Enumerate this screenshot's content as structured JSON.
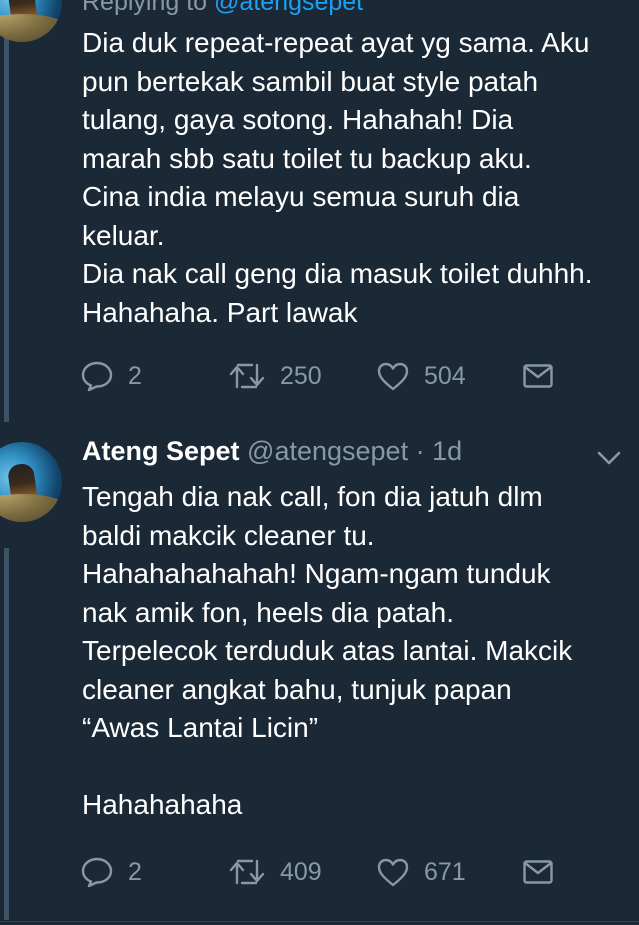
{
  "colors": {
    "background": "#1b2836",
    "text": "#ffffff",
    "secondary": "#8899a6",
    "link": "#1da1f2",
    "thread_line": "#3d5466"
  },
  "tweet1": {
    "replying_prefix": "Replying to ",
    "replying_handle": "@atengsepet",
    "text": "Dia duk repeat-repeat ayat yg sama. Aku\npun bertekak sambil buat style patah\ntulang, gaya sotong. Hahahah! Dia\nmarah sbb satu toilet tu backup aku.\nCina india melayu semua suruh dia\nkeluar.\nDia nak call geng dia masuk toilet duhhh.\nHahahaha. Part lawak",
    "replies": "2",
    "retweets": "250",
    "likes": "504"
  },
  "tweet2": {
    "author_name": "Ateng Sepet",
    "author_handle": "@atengsepet",
    "time": "· 1d",
    "text": "Tengah dia nak call, fon dia jatuh dlm\nbaldi makcik cleaner tu.\nHahahahahahah! Ngam-ngam tunduk\nnak amik fon, heels dia patah.\nTerpelecok terduduk atas lantai. Makcik\ncleaner angkat bahu, tunjuk papan\n“Awas Lantai Licin”\n\nHahahahaha",
    "replies": "2",
    "retweets": "409",
    "likes": "671"
  },
  "icons": {
    "reply": "reply-icon",
    "retweet": "retweet-icon",
    "like": "heart-icon",
    "share": "share-mail-icon",
    "more": "chevron-down-icon"
  }
}
